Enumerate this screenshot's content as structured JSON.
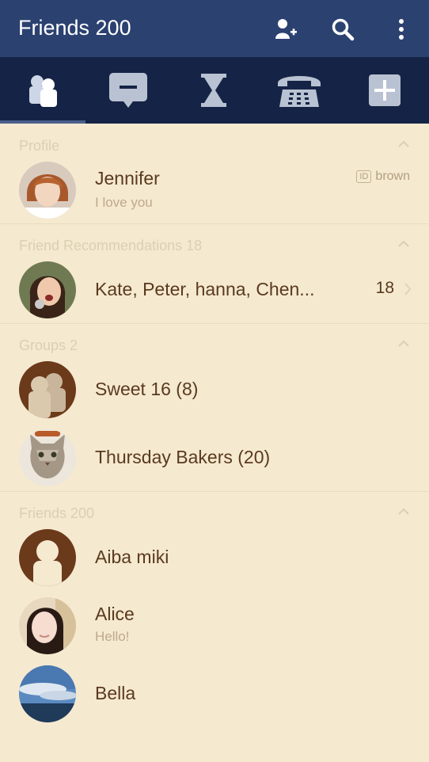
{
  "header": {
    "title": "Friends 200"
  },
  "icons": {
    "add_friend": "add-friend-icon",
    "search": "search-icon",
    "more": "more-vertical-icon"
  },
  "tabs": [
    {
      "name": "friends",
      "icon": "friends-icon",
      "active": true
    },
    {
      "name": "chats",
      "icon": "chat-icon",
      "active": false
    },
    {
      "name": "timeline",
      "icon": "hourglass-icon",
      "active": false
    },
    {
      "name": "calls",
      "icon": "phone-icon",
      "active": false
    },
    {
      "name": "more",
      "icon": "plus-icon",
      "active": false
    }
  ],
  "sections": {
    "profile": "Profile",
    "recommendations": "Friend Recommendations 18",
    "groups": "Groups 2",
    "friends": "Friends 200"
  },
  "profile": {
    "name": "Jennifer",
    "status": "I love you",
    "id_badge": "ID",
    "id_value": "brown"
  },
  "recommendations": {
    "names": "Kate, Peter, hanna, Chen...",
    "count": "18"
  },
  "groups": [
    {
      "name": "Sweet 16 (8)"
    },
    {
      "name": "Thursday Bakers (20)"
    }
  ],
  "friends": [
    {
      "name": "Aiba miki",
      "status": ""
    },
    {
      "name": "Alice",
      "status": "Hello!"
    },
    {
      "name": "Bella",
      "status": ""
    }
  ],
  "colors": {
    "header_bg": "#2b4170",
    "tabbar_bg": "#152446",
    "background": "#f5e9d0",
    "text_primary": "#5a3a1e",
    "text_secondary": "#bfa98a"
  }
}
